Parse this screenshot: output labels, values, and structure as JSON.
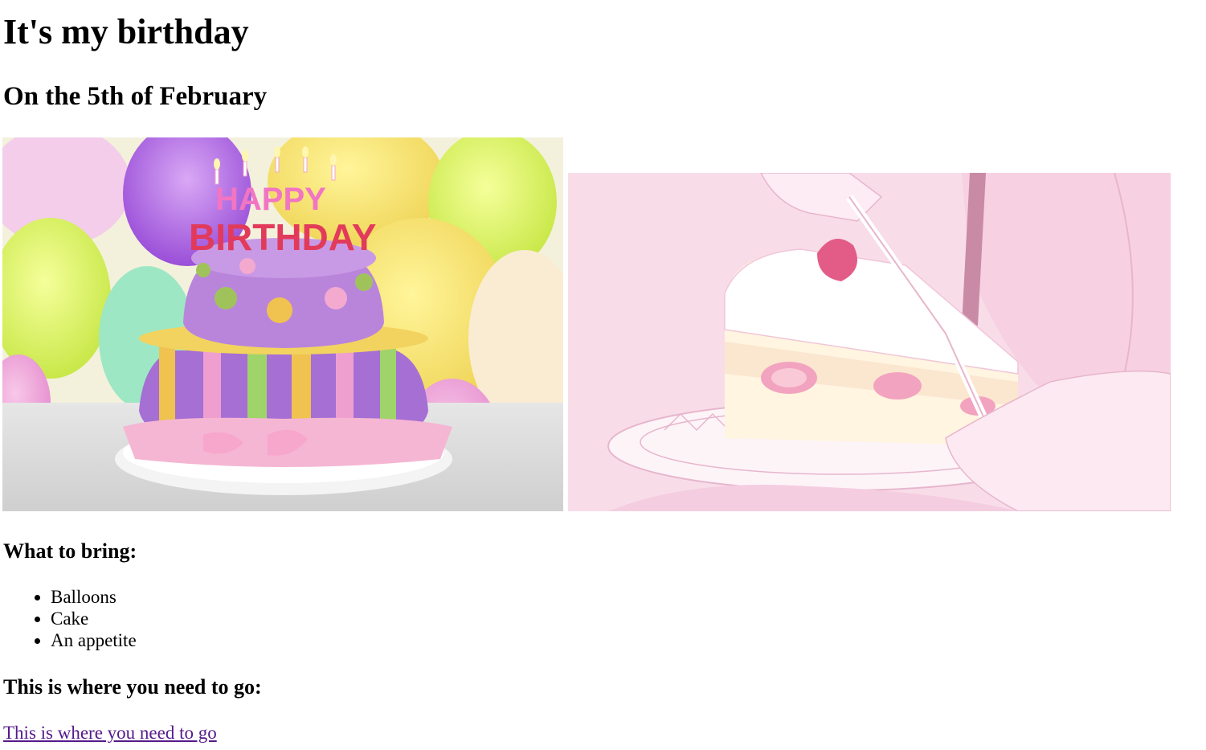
{
  "page": {
    "title": "It's my birthday",
    "subtitle": "On the 5th of February"
  },
  "images": {
    "left": {
      "description_icon": "birthday-cake-photo-image",
      "topper_line1": "HAPPY",
      "topper_line2": "BIRTHDAY"
    },
    "right": {
      "description_icon": "anime-cake-slice-image"
    }
  },
  "bring": {
    "heading": "What to bring:",
    "items": [
      "Balloons",
      "Cake",
      "An appetite"
    ]
  },
  "directions": {
    "heading": "This is where you need to go:",
    "link_text": "This is where you need to go"
  },
  "colors": {
    "link_visited": "#551a8b",
    "text": "#000000",
    "background": "#ffffff"
  }
}
